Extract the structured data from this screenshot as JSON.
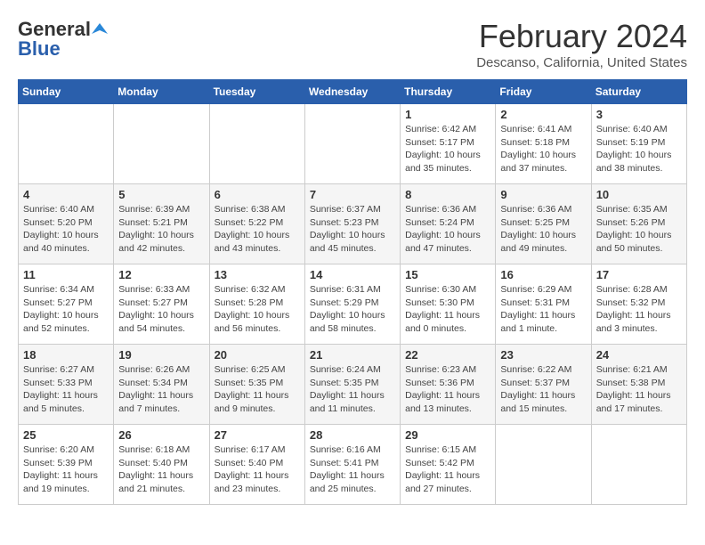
{
  "header": {
    "logo_general": "General",
    "logo_blue": "Blue",
    "month_title": "February 2024",
    "location": "Descanso, California, United States"
  },
  "calendar": {
    "days_of_week": [
      "Sunday",
      "Monday",
      "Tuesday",
      "Wednesday",
      "Thursday",
      "Friday",
      "Saturday"
    ],
    "weeks": [
      [
        {
          "day": "",
          "info": ""
        },
        {
          "day": "",
          "info": ""
        },
        {
          "day": "",
          "info": ""
        },
        {
          "day": "",
          "info": ""
        },
        {
          "day": "1",
          "info": "Sunrise: 6:42 AM\nSunset: 5:17 PM\nDaylight: 10 hours\nand 35 minutes."
        },
        {
          "day": "2",
          "info": "Sunrise: 6:41 AM\nSunset: 5:18 PM\nDaylight: 10 hours\nand 37 minutes."
        },
        {
          "day": "3",
          "info": "Sunrise: 6:40 AM\nSunset: 5:19 PM\nDaylight: 10 hours\nand 38 minutes."
        }
      ],
      [
        {
          "day": "4",
          "info": "Sunrise: 6:40 AM\nSunset: 5:20 PM\nDaylight: 10 hours\nand 40 minutes."
        },
        {
          "day": "5",
          "info": "Sunrise: 6:39 AM\nSunset: 5:21 PM\nDaylight: 10 hours\nand 42 minutes."
        },
        {
          "day": "6",
          "info": "Sunrise: 6:38 AM\nSunset: 5:22 PM\nDaylight: 10 hours\nand 43 minutes."
        },
        {
          "day": "7",
          "info": "Sunrise: 6:37 AM\nSunset: 5:23 PM\nDaylight: 10 hours\nand 45 minutes."
        },
        {
          "day": "8",
          "info": "Sunrise: 6:36 AM\nSunset: 5:24 PM\nDaylight: 10 hours\nand 47 minutes."
        },
        {
          "day": "9",
          "info": "Sunrise: 6:36 AM\nSunset: 5:25 PM\nDaylight: 10 hours\nand 49 minutes."
        },
        {
          "day": "10",
          "info": "Sunrise: 6:35 AM\nSunset: 5:26 PM\nDaylight: 10 hours\nand 50 minutes."
        }
      ],
      [
        {
          "day": "11",
          "info": "Sunrise: 6:34 AM\nSunset: 5:27 PM\nDaylight: 10 hours\nand 52 minutes."
        },
        {
          "day": "12",
          "info": "Sunrise: 6:33 AM\nSunset: 5:27 PM\nDaylight: 10 hours\nand 54 minutes."
        },
        {
          "day": "13",
          "info": "Sunrise: 6:32 AM\nSunset: 5:28 PM\nDaylight: 10 hours\nand 56 minutes."
        },
        {
          "day": "14",
          "info": "Sunrise: 6:31 AM\nSunset: 5:29 PM\nDaylight: 10 hours\nand 58 minutes."
        },
        {
          "day": "15",
          "info": "Sunrise: 6:30 AM\nSunset: 5:30 PM\nDaylight: 11 hours\nand 0 minutes."
        },
        {
          "day": "16",
          "info": "Sunrise: 6:29 AM\nSunset: 5:31 PM\nDaylight: 11 hours\nand 1 minute."
        },
        {
          "day": "17",
          "info": "Sunrise: 6:28 AM\nSunset: 5:32 PM\nDaylight: 11 hours\nand 3 minutes."
        }
      ],
      [
        {
          "day": "18",
          "info": "Sunrise: 6:27 AM\nSunset: 5:33 PM\nDaylight: 11 hours\nand 5 minutes."
        },
        {
          "day": "19",
          "info": "Sunrise: 6:26 AM\nSunset: 5:34 PM\nDaylight: 11 hours\nand 7 minutes."
        },
        {
          "day": "20",
          "info": "Sunrise: 6:25 AM\nSunset: 5:35 PM\nDaylight: 11 hours\nand 9 minutes."
        },
        {
          "day": "21",
          "info": "Sunrise: 6:24 AM\nSunset: 5:35 PM\nDaylight: 11 hours\nand 11 minutes."
        },
        {
          "day": "22",
          "info": "Sunrise: 6:23 AM\nSunset: 5:36 PM\nDaylight: 11 hours\nand 13 minutes."
        },
        {
          "day": "23",
          "info": "Sunrise: 6:22 AM\nSunset: 5:37 PM\nDaylight: 11 hours\nand 15 minutes."
        },
        {
          "day": "24",
          "info": "Sunrise: 6:21 AM\nSunset: 5:38 PM\nDaylight: 11 hours\nand 17 minutes."
        }
      ],
      [
        {
          "day": "25",
          "info": "Sunrise: 6:20 AM\nSunset: 5:39 PM\nDaylight: 11 hours\nand 19 minutes."
        },
        {
          "day": "26",
          "info": "Sunrise: 6:18 AM\nSunset: 5:40 PM\nDaylight: 11 hours\nand 21 minutes."
        },
        {
          "day": "27",
          "info": "Sunrise: 6:17 AM\nSunset: 5:40 PM\nDaylight: 11 hours\nand 23 minutes."
        },
        {
          "day": "28",
          "info": "Sunrise: 6:16 AM\nSunset: 5:41 PM\nDaylight: 11 hours\nand 25 minutes."
        },
        {
          "day": "29",
          "info": "Sunrise: 6:15 AM\nSunset: 5:42 PM\nDaylight: 11 hours\nand 27 minutes."
        },
        {
          "day": "",
          "info": ""
        },
        {
          "day": "",
          "info": ""
        }
      ]
    ]
  }
}
